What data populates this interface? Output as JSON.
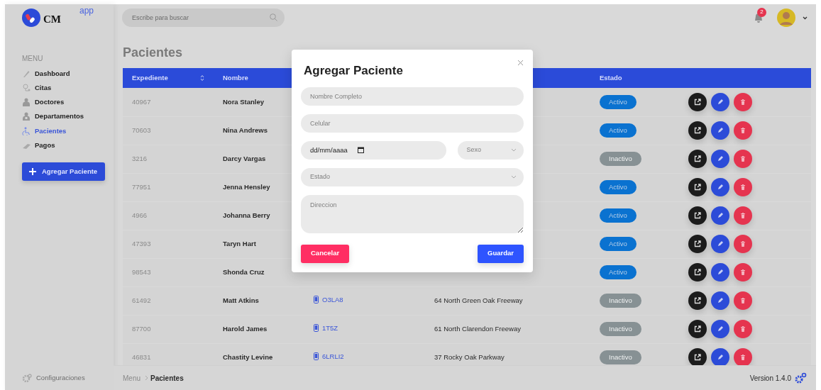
{
  "brand": {
    "logo_text": "CM",
    "tag": "app"
  },
  "search": {
    "placeholder": "Escribe para buscar"
  },
  "notifications": {
    "count": "2"
  },
  "sidebar": {
    "heading": "MENU",
    "items": [
      {
        "label": "Dashboard",
        "selected": false
      },
      {
        "label": "Citas",
        "selected": false
      },
      {
        "label": "Doctores",
        "selected": false
      },
      {
        "label": "Departamentos",
        "selected": false
      },
      {
        "label": "Pacientes",
        "selected": true
      },
      {
        "label": "Pagos",
        "selected": false
      }
    ],
    "add_button": "Agregar Paciente",
    "settings": "Configuraciones"
  },
  "page": {
    "title": "Pacientes"
  },
  "table": {
    "columns": [
      "Expediente",
      "Nombre",
      "Estado"
    ],
    "rows": [
      {
        "expediente": "40967",
        "nombre": "Nora Stanley",
        "estado": "Activo",
        "active": true
      },
      {
        "expediente": "70603",
        "nombre": "Nina Andrews",
        "estado": "Activo",
        "active": true
      },
      {
        "expediente": "3216",
        "nombre": "Darcy Vargas",
        "estado": "Inactivo",
        "active": false
      },
      {
        "expediente": "77951",
        "nombre": "Jenna Hensley",
        "estado": "Activo",
        "active": true
      },
      {
        "expediente": "4966",
        "nombre": "Johanna Berry",
        "estado": "Activo",
        "active": true
      },
      {
        "expediente": "47393",
        "nombre": "Taryn Hart",
        "estado": "Activo",
        "active": true
      },
      {
        "expediente": "98543",
        "nombre": "Shonda Cruz",
        "estado": "Activo",
        "active": true
      },
      {
        "expediente": "61492",
        "nombre": "Matt Atkins",
        "celular": "O3LA8",
        "direccion": "64 North Green Oak Freeway",
        "estado": "Inactivo",
        "active": false
      },
      {
        "expediente": "87700",
        "nombre": "Harold James",
        "celular": "1T5Z",
        "direccion": "61 North Clarendon Freeway",
        "estado": "Inactivo",
        "active": false
      },
      {
        "expediente": "46831",
        "nombre": "Chastity Levine",
        "celular": "6LRLI2",
        "direccion": "37 Rocky Oak Parkway",
        "estado": "Inactivo",
        "active": false
      }
    ]
  },
  "footer": {
    "breadcrumb": [
      "Menu",
      "Pacientes"
    ],
    "version": "Version 1.4.0"
  },
  "modal": {
    "title": "Agregar Paciente",
    "field_rows": [
      [
        {
          "kind": "text",
          "placeholder": "Nombre Completo"
        }
      ],
      [
        {
          "kind": "text",
          "placeholder": "Celular"
        }
      ],
      [
        {
          "kind": "date",
          "value": "dd/mm/aaaa"
        },
        {
          "kind": "select",
          "placeholder": "Sexo"
        }
      ],
      [
        {
          "kind": "select",
          "placeholder": "Estado"
        }
      ],
      [
        {
          "kind": "textarea",
          "placeholder": "Direccion"
        }
      ]
    ],
    "buttons": [
      {
        "kind": "cancel",
        "label": "Cancelar"
      },
      {
        "kind": "save",
        "label": "Guardar"
      }
    ]
  }
}
